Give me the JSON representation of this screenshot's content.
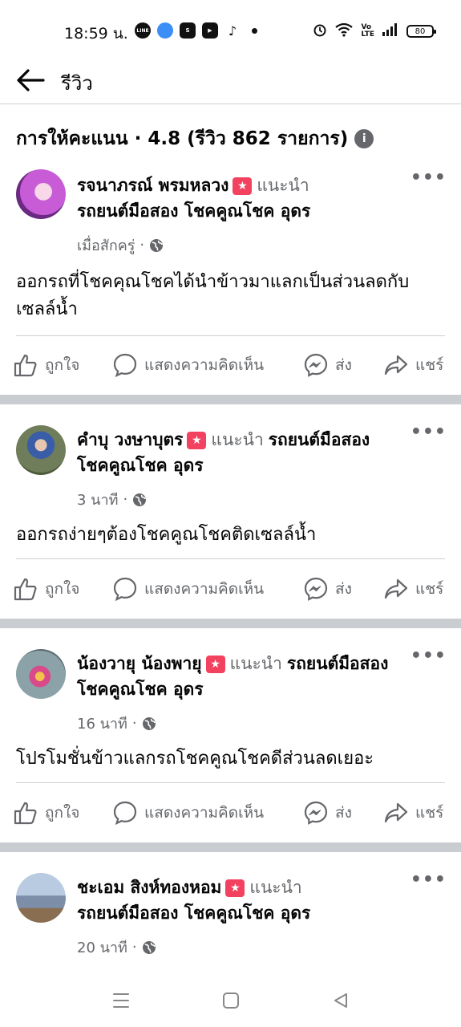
{
  "status_bar": {
    "time": "18:59 น.",
    "battery": "80",
    "app_icons": [
      "line-icon",
      "messenger-icon",
      "shopee-icon",
      "youtube-icon",
      "tiktok-icon"
    ]
  },
  "header": {
    "title": "รีวิว"
  },
  "rating": {
    "summary": "การให้คะแนน · 4.8 (รีวิว 862 รายการ)"
  },
  "reviews": [
    {
      "name": "รจนาภรณ์ พรมหลวง",
      "recommends": "แนะนำ",
      "page": "รถยนต์มือสอง โชคคูณโชค อุดร",
      "time": "เมื่อสักครู่",
      "text": "ออกรถที่โชคคุณโชคได้นำข้าวมาแลกเป็นส่วนลดกับเซลล์น้ำ",
      "avatar_color": "#c75cd6"
    },
    {
      "name": "คำบุ วงษาบุตร",
      "recommends": "แนะนำ",
      "page": "รถยนต์มือสอง โชคคูณโชค อุดร",
      "time": "3 นาที",
      "text": "ออกรถง่ายๆต้องโชคคูณโชคติดเซลล์น้ำ",
      "avatar_color": "#6f7d5a"
    },
    {
      "name": "น้องวายุ น้องพายุ",
      "recommends": "แนะนำ",
      "page": "รถยนต์มือสอง โชคคูณโชค อุดร",
      "time": "16 นาที",
      "text": "โปรโมชั่นข้าวแลกรถโชคคูณโชคดีส่วนลดเยอะ",
      "avatar_color": "#8aa2a8"
    },
    {
      "name": "ชะเอม สิงห์ทองหอม",
      "recommends": "แนะนำ",
      "page": "รถยนต์มือสอง โชคคูณโชค อุดร",
      "time": "20 นาที",
      "avatar_color": "#7d8fa8"
    }
  ],
  "actions": {
    "like": "ถูกใจ",
    "comment": "แสดงความคิดเห็น",
    "send": "ส่ง",
    "share": "แชร์"
  }
}
